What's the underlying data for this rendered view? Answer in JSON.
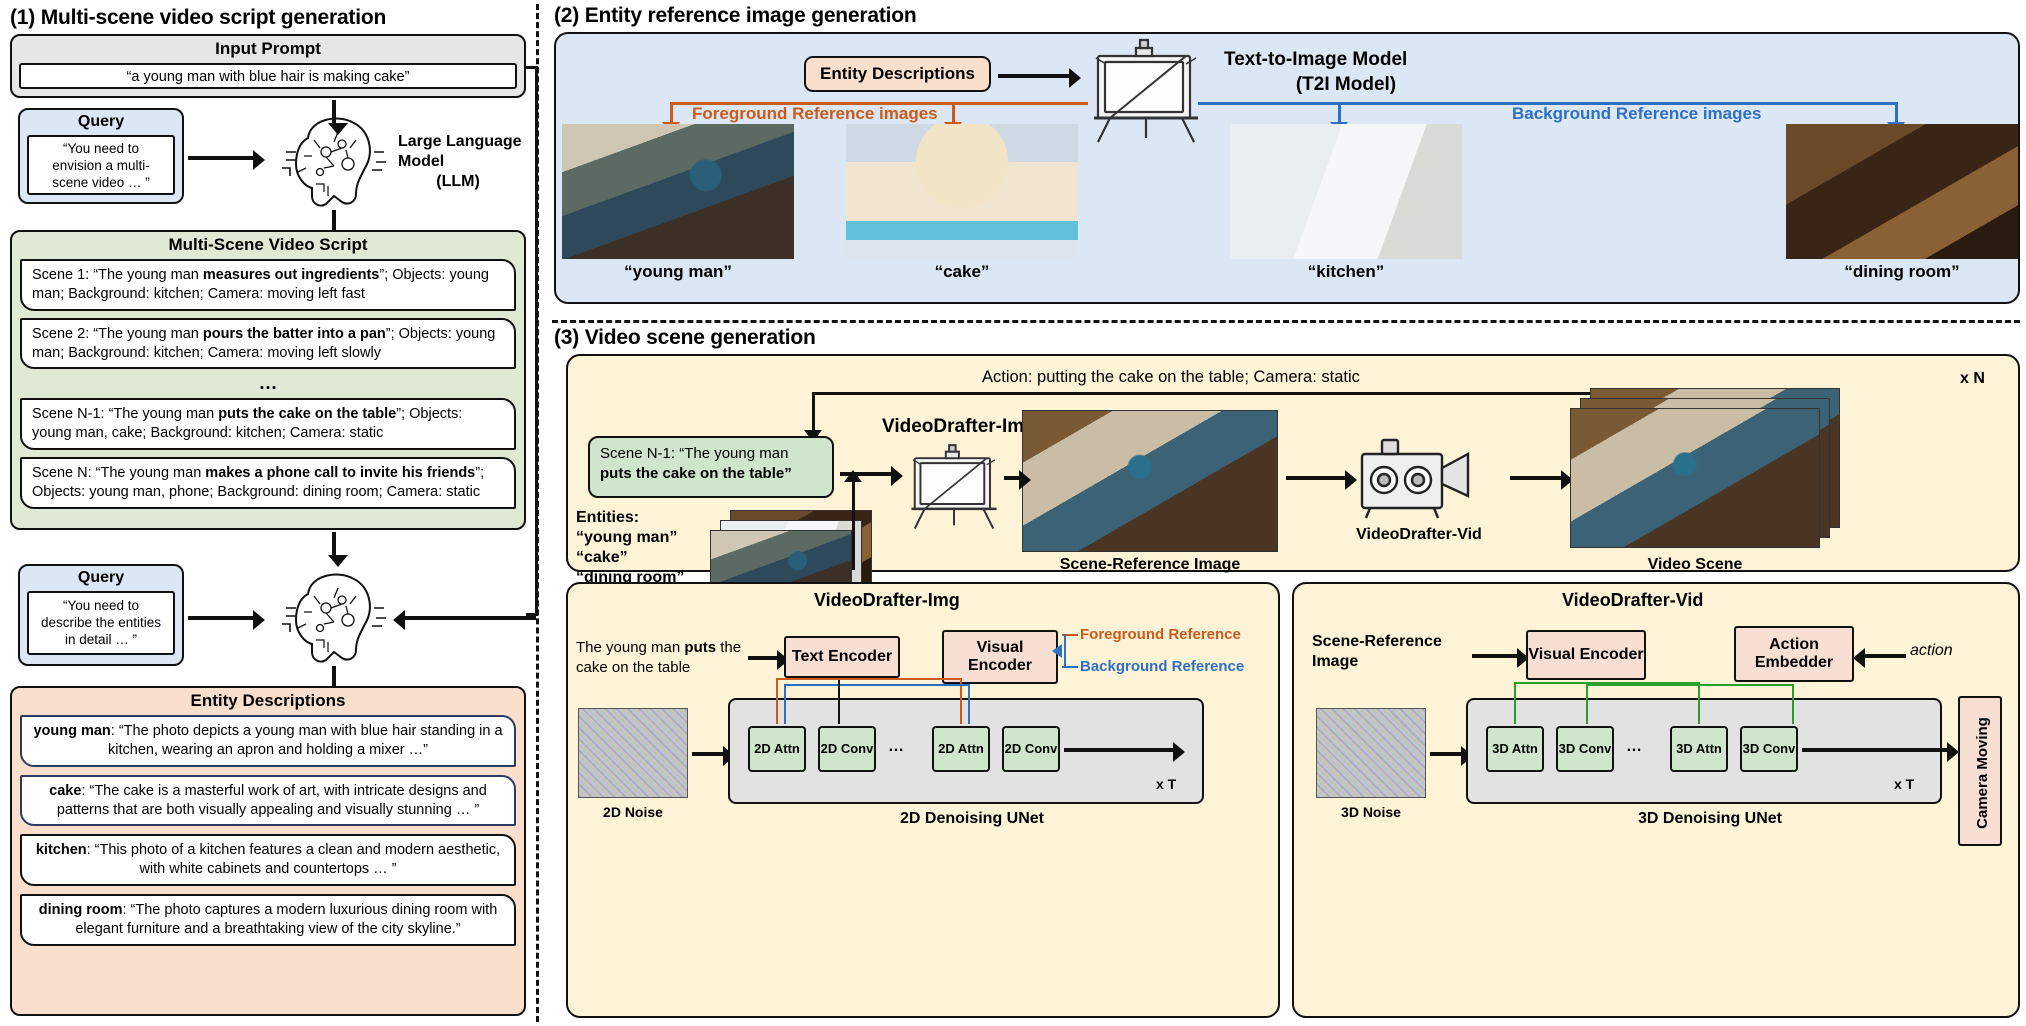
{
  "sections": {
    "s1_title": "(1) Multi-scene video script generation",
    "s2_title": "(2) Entity reference image generation",
    "s3_title": "(3) Video scene generation"
  },
  "s1": {
    "input_prompt": {
      "header": "Input Prompt",
      "text": "“a young man with blue hair is making cake”"
    },
    "query1": {
      "header": "Query",
      "text": "“You need to envision a multi-scene video … ”"
    },
    "llm_label_line1": "Large Language Model",
    "llm_label_line2": "(LLM)",
    "script": {
      "header": "Multi-Scene Video Script",
      "ellipsis": "…",
      "scenes": [
        {
          "prefix": "Scene 1: “The young man ",
          "bold": "measures out ingredients",
          "suffix": "”; Objects: young man; Background: kitchen; Camera: moving left fast"
        },
        {
          "prefix": "Scene 2: “The young man ",
          "bold": "pours the batter into a pan",
          "suffix": "”; Objects: young man; Background: kitchen; Camera: moving left slowly"
        },
        {
          "prefix": "Scene N-1: “The young man ",
          "bold": "puts the cake on the table",
          "suffix": "”; Objects: young man, cake; Background: kitchen; Camera: static"
        },
        {
          "prefix": "Scene N: “The young man ",
          "bold": "makes a phone call to invite his friends",
          "suffix": "”; Objects: young man, phone; Background: dining room; Camera: static"
        }
      ]
    },
    "query2": {
      "header": "Query",
      "text": "“You need to describe the entities in detail … ”"
    },
    "entity_desc": {
      "header": "Entity Descriptions",
      "items": [
        {
          "name": "young man",
          "text": ": “The photo depicts a young man with blue hair standing in a kitchen, wearing an apron and holding a mixer …”"
        },
        {
          "name": "cake",
          "text": ": “The cake is a masterful work of art, with intricate designs and patterns that are both visually appealing and visually stunning … ”"
        },
        {
          "name": "kitchen",
          "text": ": “This photo of a kitchen features a clean and modern aesthetic, with white cabinets and countertops … ”"
        },
        {
          "name": "dining room",
          "text": ": “The photo captures a modern luxurious dining room with elegant furniture and a breathtaking view of the city skyline.”"
        }
      ]
    }
  },
  "s2": {
    "entity_descriptions_pill": "Entity Descriptions",
    "t2i_line1": "Text-to-Image Model",
    "t2i_line2": "(T2I Model)",
    "foreground_label": "Foreground Reference images",
    "background_label": "Background Reference images",
    "references": [
      {
        "caption": "“young man”",
        "kind": "foreground"
      },
      {
        "caption": "“cake”",
        "kind": "foreground"
      },
      {
        "caption": "“kitchen”",
        "kind": "background"
      },
      {
        "caption": "“dining room”",
        "kind": "background"
      }
    ]
  },
  "s3": {
    "action_note": "Action: putting the cake on the table; Camera: static",
    "xn": "x N",
    "scene_box": {
      "line1": "Scene N-1: “The young man",
      "line2": "puts the cake on the table”"
    },
    "entities_title": "Entities:",
    "entities": [
      "“young man”",
      "“cake”",
      "“dining room”"
    ],
    "videodrafter_img": "VideoDrafter-Img",
    "videodrafter_vid": "VideoDrafter-Vid",
    "scene_reference_image": "Scene-Reference Image",
    "video_scene": "Video Scene",
    "img_detail": {
      "title": "VideoDrafter-Img",
      "prompt_prefix": "The young man ",
      "prompt_bold": "puts",
      "prompt_suffix": "the cake on the table",
      "text_encoder": "Text Encoder",
      "visual_encoder": "Visual Encoder",
      "foreground_ref": "Foreground Reference",
      "background_ref": "Background Reference",
      "noise_label": "2D Noise",
      "unet_label": "2D Denoising UNet",
      "xt": "x T",
      "blocks": [
        "2D Attn",
        "2D Conv",
        "…",
        "2D Attn",
        "2D Conv"
      ]
    },
    "vid_detail": {
      "title": "VideoDrafter-Vid",
      "scene_ref_line1": "Scene-Reference",
      "scene_ref_line2": "Image",
      "visual_encoder": "Visual Encoder",
      "action_embedder": "Action Embedder",
      "action_italic": "action",
      "noise_label": "3D Noise",
      "unet_label": "3D Denoising UNet",
      "xt": "x T",
      "blocks": [
        "3D Attn",
        "3D Conv",
        "…",
        "3D Attn",
        "3D Conv"
      ],
      "camera_moving": "Camera Moving"
    }
  },
  "colors": {
    "blue_panel": "#dbe7f5",
    "yellow_panel": "#fdf3d7",
    "green_panel": "#dfe9d4",
    "peach_panel": "#fae0cc",
    "orange_accent": "#cc5a1a",
    "blue_accent": "#2f6fc4"
  }
}
